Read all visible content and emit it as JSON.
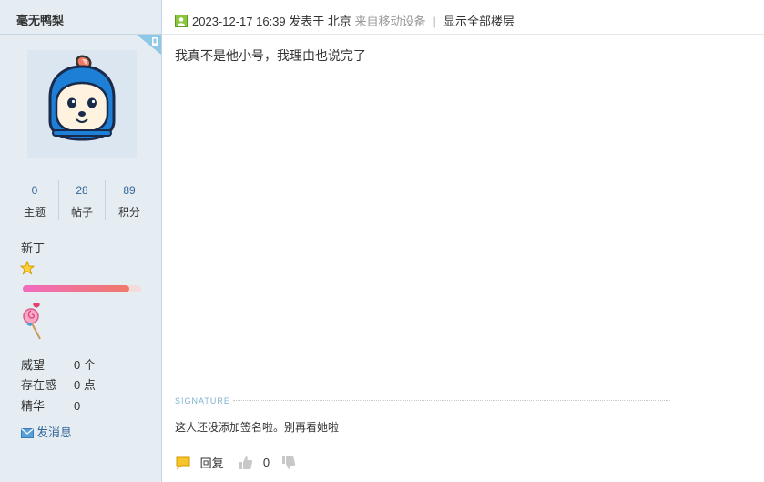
{
  "user": {
    "name": "毫无鸭梨",
    "stats": [
      {
        "value": "0",
        "label": "主题"
      },
      {
        "value": "28",
        "label": "帖子"
      },
      {
        "value": "89",
        "label": "积分"
      }
    ],
    "rank": "新丁",
    "level_progress": 0.9,
    "info": [
      {
        "key": "威望",
        "value": "0 个"
      },
      {
        "key": "存在感",
        "value": "0 点"
      },
      {
        "key": "精华",
        "value": "0"
      }
    ],
    "send_message": "发消息"
  },
  "post": {
    "datetime": "2023-12-17 16:39",
    "posted_at": "发表于 北京",
    "source": "来自移动设备",
    "separator": "|",
    "show_all": "显示全部楼层",
    "content": "我真不是他小号，我理由也说完了",
    "signature_label": "SIGNATURE",
    "signature": "这人还没添加签名啦。别再看她啦"
  },
  "actions": {
    "reply": "回复",
    "like_count": "0"
  },
  "icons": [
    "mobile-device-icon",
    "avatar-image",
    "star-icon",
    "lollipop-medal-icon",
    "envelope-icon",
    "online-status-icon",
    "reply-icon",
    "thumbs-up-icon",
    "thumbs-down-icon"
  ],
  "colors": {
    "sidebar_bg": "#e5edf2",
    "link": "#336699",
    "border": "#c2d5e3"
  }
}
